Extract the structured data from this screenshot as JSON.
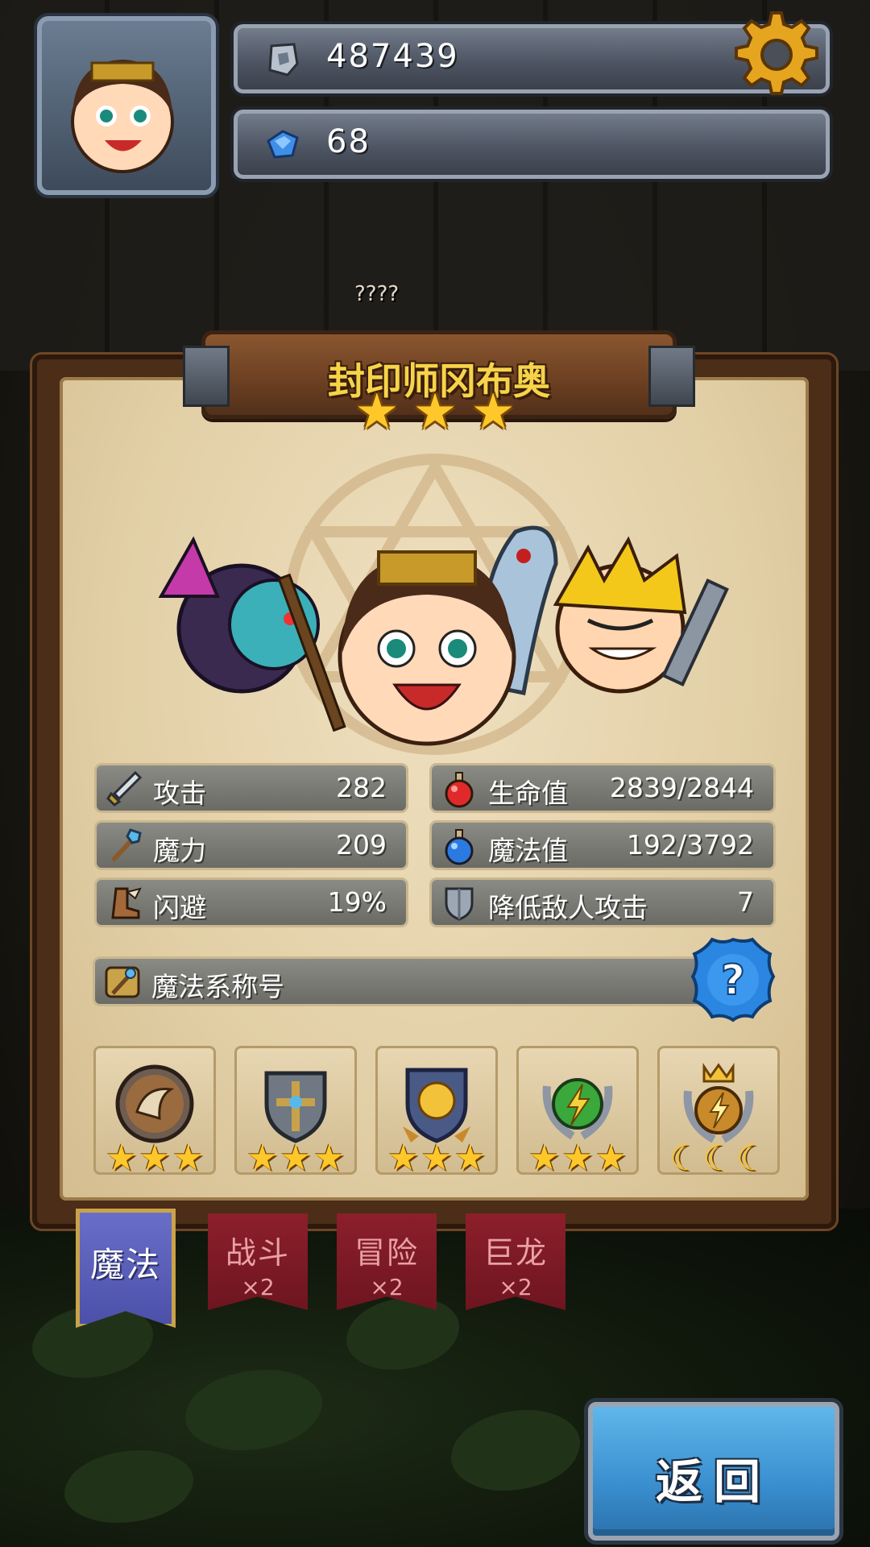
{
  "hud": {
    "stone_value": "487439",
    "gem_value": "68"
  },
  "background": {
    "enemy_label": "????"
  },
  "hero": {
    "name": "封印师冈布奥",
    "stars": 3
  },
  "stats": {
    "attack": {
      "label": "攻击",
      "value": "282"
    },
    "magic_power": {
      "label": "魔力",
      "value": "209"
    },
    "dodge": {
      "label": "闪避",
      "value": "19%"
    },
    "hp": {
      "label": "生命值",
      "value": "2839/2844"
    },
    "mp": {
      "label": "魔法值",
      "value": "192/3792"
    },
    "reduce_attack": {
      "label": "降低敌人攻击",
      "value": "7"
    }
  },
  "title_row": {
    "label": "魔法系称号"
  },
  "badges": [
    {
      "icon": "horn-emblem-icon",
      "rating": "3 stars"
    },
    {
      "icon": "cross-shield-emblem-icon",
      "rating": "3 stars"
    },
    {
      "icon": "sun-shield-emblem-icon",
      "rating": "3 stars"
    },
    {
      "icon": "lightning-laurel-emblem-icon",
      "rating": "3 stars"
    },
    {
      "icon": "crown-lightning-emblem-icon",
      "rating": "3 moons"
    }
  ],
  "tabs": [
    {
      "label": "魔法",
      "multiplier": "",
      "active": true
    },
    {
      "label": "战斗",
      "multiplier": "×2",
      "active": false
    },
    {
      "label": "冒险",
      "multiplier": "×2",
      "active": false
    },
    {
      "label": "巨龙",
      "multiplier": "×2",
      "active": false
    }
  ],
  "back_button": {
    "label": "返回"
  },
  "colors": {
    "accent_gold": "#f7d34a",
    "tab_active": "#5a5fbb",
    "tab_inactive": "#7e1a25",
    "back_button": "#3a8fcf"
  }
}
